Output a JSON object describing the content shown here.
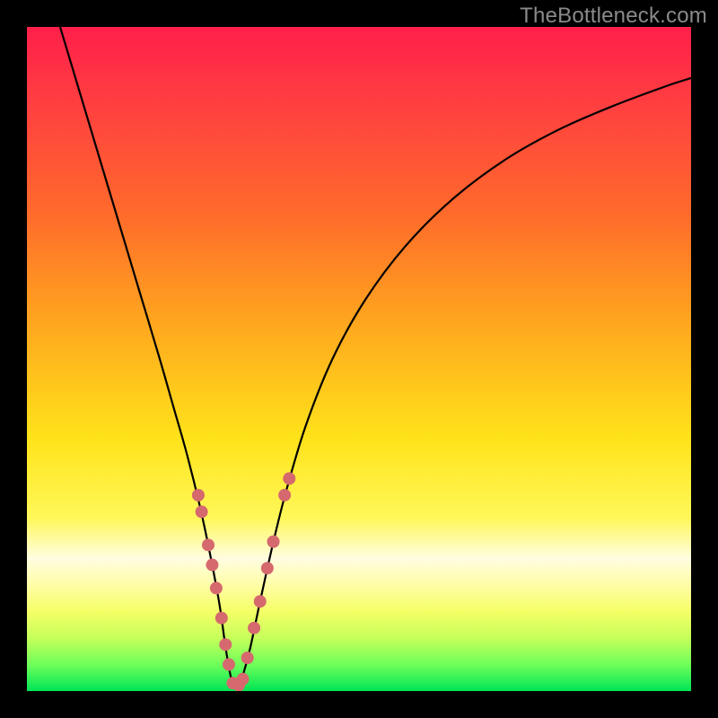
{
  "watermark": "TheBottleneck.com",
  "chart_data": {
    "type": "line",
    "title": "",
    "xlabel": "",
    "ylabel": "",
    "xlim": [
      0,
      100
    ],
    "ylim": [
      0,
      100
    ],
    "curve": {
      "name": "bottleneck-curve",
      "x": [
        5,
        8,
        11,
        14,
        17,
        20,
        22,
        24,
        26,
        27.5,
        29,
        30,
        31,
        32,
        33.5,
        35,
        37,
        39,
        42,
        46,
        51,
        57,
        64,
        72,
        80,
        88,
        96,
        100
      ],
      "y": [
        100,
        90,
        80,
        70,
        60,
        50,
        43,
        36,
        28,
        21,
        13,
        6,
        1,
        1,
        6,
        13,
        22,
        30,
        40,
        50,
        59,
        67,
        74,
        80,
        84.5,
        88,
        91,
        92.3
      ]
    },
    "markers_left": {
      "name": "left-markers",
      "color": "#d5696e",
      "points": [
        {
          "x": 25.8,
          "y": 29.5
        },
        {
          "x": 26.3,
          "y": 27.0
        },
        {
          "x": 27.3,
          "y": 22.0
        },
        {
          "x": 27.9,
          "y": 19.0
        },
        {
          "x": 28.5,
          "y": 15.5
        },
        {
          "x": 29.3,
          "y": 11.0
        },
        {
          "x": 29.9,
          "y": 7.0
        },
        {
          "x": 30.4,
          "y": 4.0
        },
        {
          "x": 31.0,
          "y": 1.2
        },
        {
          "x": 31.9,
          "y": 0.9
        },
        {
          "x": 32.5,
          "y": 1.8
        },
        {
          "x": 33.2,
          "y": 5.0
        }
      ]
    },
    "markers_right": {
      "name": "right-markers",
      "color": "#d5696e",
      "points": [
        {
          "x": 34.2,
          "y": 9.5
        },
        {
          "x": 35.1,
          "y": 13.5
        },
        {
          "x": 36.2,
          "y": 18.5
        },
        {
          "x": 37.1,
          "y": 22.5
        },
        {
          "x": 38.8,
          "y": 29.5
        },
        {
          "x": 39.5,
          "y": 32.0
        }
      ]
    },
    "marker_radius": 7.0
  }
}
